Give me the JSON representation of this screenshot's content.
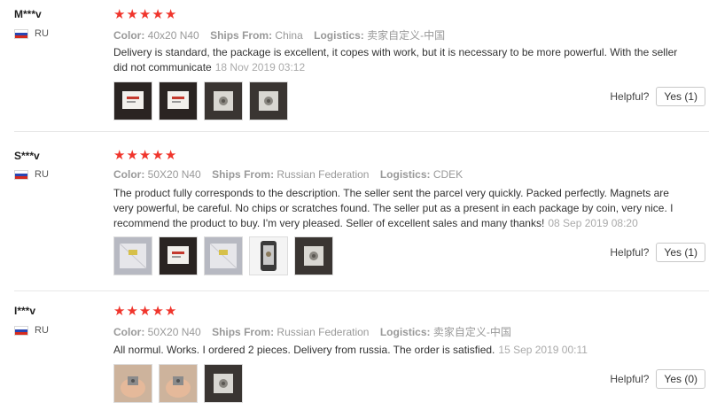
{
  "labels": {
    "color": "Color:",
    "ships_from": "Ships From:",
    "logistics": "Logistics:",
    "helpful": "Helpful?"
  },
  "flag_colors": [
    "#ffffff",
    "#2846b4",
    "#d52b1e"
  ],
  "star_color": "#f0352c",
  "reviews": [
    {
      "user": "M***v",
      "country": "RU",
      "rating": 5,
      "color": "40x20 N40",
      "ships_from": "China",
      "logistics": "卖家自定义-中国",
      "text": "Delivery is standard, the package is excellent, it copes with work, but it is necessary to be more powerful. With the seller did not communicate",
      "date": "18 Nov 2019 03:12",
      "photos": [
        "magnet-package-photo",
        "magnet-package-photo",
        "magnet-close-up-photo",
        "magnet-close-up-photo"
      ],
      "helpful_count": "Yes (1)"
    },
    {
      "user": "S***v",
      "country": "RU",
      "rating": 5,
      "color": "50X20  N40",
      "ships_from": "Russian Federation",
      "logistics": "CDEK",
      "text": "The product fully corresponds to the description. The seller sent the parcel very quickly. Packed perfectly. Magnets are very powerful, be careful. No chips or scratches found. The seller put as a present in each package by coin, very nice. I recommend the product to buy. I'm very pleased. Seller of excellent sales and many thanks!",
      "date": "08 Sep 2019 08:20",
      "photos": [
        "parcel-photo",
        "magnet-package-photo",
        "parcel-photo",
        "phone-magnet-photo",
        "magnet-close-up-photo"
      ],
      "helpful_count": "Yes (1)"
    },
    {
      "user": "I***v",
      "country": "RU",
      "rating": 5,
      "color": "50X20  N40",
      "ships_from": "Russian Federation",
      "logistics": "卖家自定义-中国",
      "text": "All normul. Works. I ordered 2 pieces. Delivery from russia. The order is satisfied.",
      "date": "15 Sep 2019 00:11",
      "photos": [
        "hand-magnet-photo",
        "hand-magnet-photo",
        "magnet-close-up-photo"
      ],
      "helpful_count": "Yes (0)"
    }
  ]
}
